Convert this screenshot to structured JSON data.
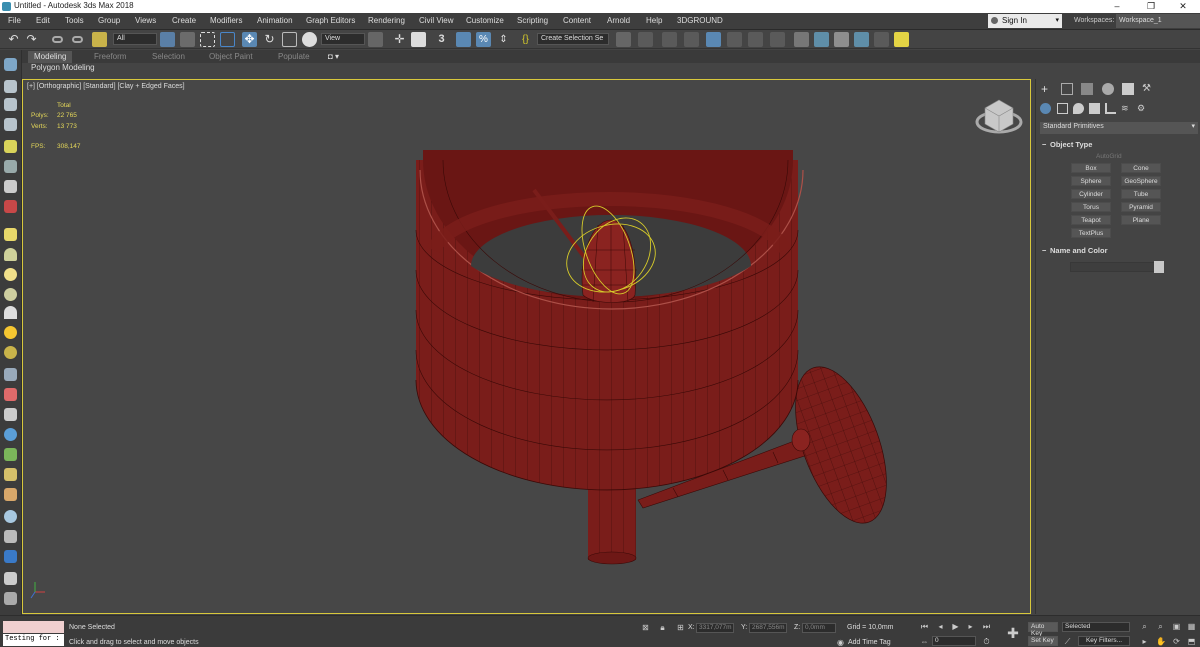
{
  "window": {
    "title": "Untitled - Autodesk 3ds Max 2018",
    "minimize": "–",
    "maximize": "❐",
    "close": "✕"
  },
  "menu": [
    "File",
    "Edit",
    "Tools",
    "Group",
    "Views",
    "Create",
    "Modifiers",
    "Animation",
    "Graph Editors",
    "Rendering",
    "Civil View",
    "Customize",
    "Scripting",
    "Content",
    "Arnold",
    "Help",
    "3DGROUND"
  ],
  "account": {
    "signin": "Sign In",
    "workspaces_label": "Workspaces:",
    "workspace": "Workspace_1"
  },
  "toolbar": {
    "selection_filter": "All",
    "ref_coord": "View",
    "named_selection": "Create Selection Se",
    "snap_value": "3"
  },
  "ribbon": {
    "tabs": [
      "Modeling",
      "Freeform",
      "Selection",
      "Object Paint",
      "Populate"
    ],
    "active_tab": "Modeling",
    "subpanel": "Polygon Modeling"
  },
  "viewport": {
    "label": "[+] [Orthographic] [Standard] [Clay + Edged Faces]",
    "stats": {
      "total_label": "Total",
      "polys_label": "Polys:",
      "polys": "22 765",
      "verts_label": "Verts:",
      "verts": "13 773",
      "fps_label": "FPS:",
      "fps": "308,147"
    }
  },
  "command_panel": {
    "dropdown": "Standard Primitives",
    "object_type_title": "Object Type",
    "autogrid": "AutoGrid",
    "object_buttons": [
      "Box",
      "Cone",
      "Sphere",
      "GeoSphere",
      "Cylinder",
      "Tube",
      "Torus",
      "Pyramid",
      "Teapot",
      "Plane",
      "TextPlus"
    ],
    "name_color_title": "Name and Color"
  },
  "statusbar": {
    "maxscript": "Testing for :",
    "selection": "None Selected",
    "prompt": "Click and drag to select and move objects",
    "x_label": "X:",
    "x": "3317,077m",
    "y_label": "Y:",
    "y": "2687,556m",
    "z_label": "Z:",
    "z": "0,0mm",
    "grid": "Grid = 10,0mm",
    "add_time_tag": "Add Time Tag",
    "auto_key": "Auto Key",
    "set_key": "Set Key",
    "key_mode": "Selected",
    "key_filters": "Key Filters...",
    "frame": "0"
  },
  "colors": {
    "viewport_bg": "#474747",
    "model": "#7a1d1a",
    "wire": "#3a0907",
    "gizmo": "#d6cb2a",
    "active_border": "#d8c83c"
  }
}
